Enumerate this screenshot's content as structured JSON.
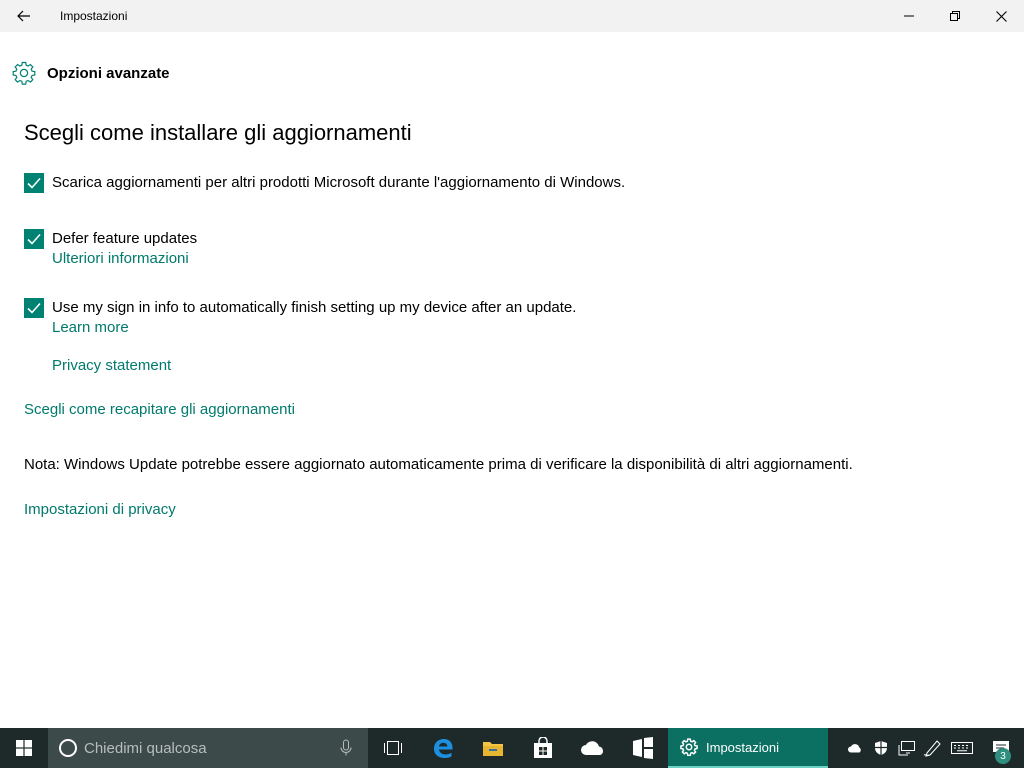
{
  "window": {
    "title": "Impostazioni"
  },
  "header": {
    "title": "Opzioni avanzate",
    "icon": "gear-icon"
  },
  "main": {
    "section_title": "Scegli come installare gli aggiornamenti",
    "options": [
      {
        "label": "Scarica aggiornamenti per altri prodotti Microsoft durante l'aggiornamento di Windows.",
        "checked": true
      },
      {
        "label": "Defer feature updates",
        "checked": true,
        "link": "Ulteriori informazioni"
      },
      {
        "label": "Use my sign in info to automatically finish setting up my device after an update.",
        "checked": true,
        "link": "Learn more",
        "link2": "Privacy statement"
      }
    ],
    "delivery_link": "Scegli come recapitare gli aggiornamenti",
    "note": "Nota: Windows Update potrebbe essere aggiornato automaticamente prima di verificare la disponibilità di altri aggiornamenti.",
    "privacy_link": "Impostazioni di privacy"
  },
  "taskbar": {
    "search_placeholder": "Chiedimi qualcosa",
    "active_app": "Impostazioni",
    "notification_count": "3"
  },
  "colors": {
    "accent": "#008272",
    "link": "#007a6c",
    "taskbar": "#1e2a2a",
    "titlebar": "#f2f2f2"
  }
}
